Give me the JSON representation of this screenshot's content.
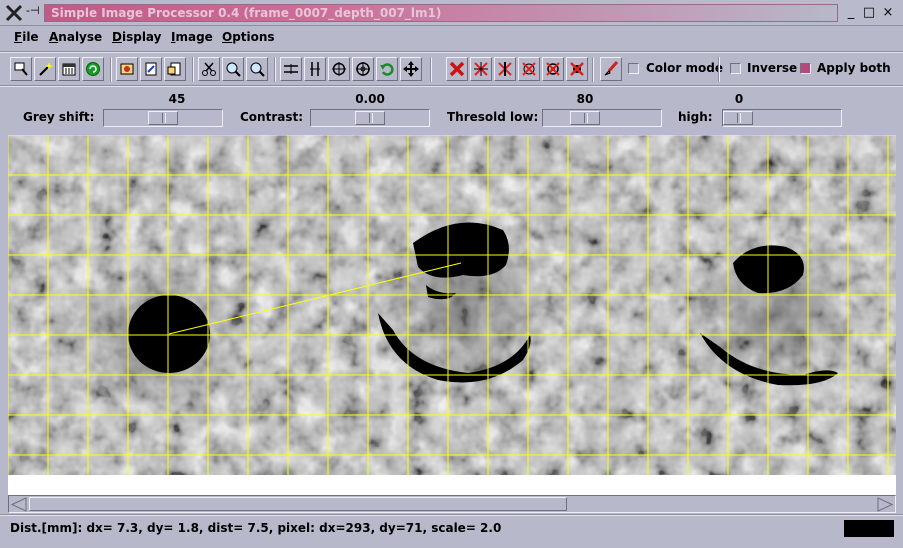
{
  "window": {
    "title": "Simple Image Processor 0.4 (frame_0007_depth_007_lm1)",
    "pin_glyph": "-⊣",
    "buttons": {
      "minimize": "_",
      "maximize": "□",
      "close": "×"
    }
  },
  "menu": {
    "items": [
      {
        "label": "File",
        "mnemonic": "F",
        "rest": "ile"
      },
      {
        "label": "Analyse",
        "mnemonic": "A",
        "rest": "nalyse"
      },
      {
        "label": "Display",
        "mnemonic": "D",
        "rest": "isplay"
      },
      {
        "label": "Image",
        "mnemonic": "I",
        "rest": "mage"
      },
      {
        "label": "Options",
        "mnemonic": "O",
        "rest": "ptions"
      }
    ]
  },
  "toolbar": {
    "icons": [
      "select-icon",
      "magic-wand-icon",
      "calendar-icon",
      "refresh-circle-icon",
      "image-load-icon",
      "image-save-icon",
      "image-export-icon",
      "scissors-icon",
      "zoom-in-icon",
      "zoom-out-icon",
      "hline-icon",
      "vline-icon",
      "circle-target-icon",
      "crosshair-circle-icon",
      "undo-arrow-icon",
      "move-icon",
      "delete-icon",
      "clear-cross-icon",
      "clear-star-icon",
      "clear-box-icon",
      "clear-dot-icon",
      "clear-all-icon",
      "brush-icon"
    ],
    "color_mode": {
      "label": "Color mode",
      "checked": false
    },
    "inverse": {
      "label": "Inverse",
      "checked": false
    },
    "apply_both": {
      "label": "Apply both",
      "checked": true
    },
    "accent": "#b44a7a"
  },
  "sliders": {
    "grey_shift": {
      "label": "Grey shift:",
      "value": "45",
      "fraction": 0.5
    },
    "contrast": {
      "label": "Contrast:",
      "value": "0.00",
      "fraction": 0.5
    },
    "threshold_low": {
      "label": "Thresold low:",
      "value": "80",
      "fraction": 0.31
    },
    "threshold_high": {
      "label": "high:",
      "value": "0",
      "fraction": 0.0
    }
  },
  "canvas": {
    "grid_color": "#ffff00",
    "measure_line_color": "#ffff00"
  },
  "status": {
    "text": "Dist.[mm]: dx= 7.3, dy= 1.8, dist= 7.5, pixel: dx=293, dy=71, scale= 2.0"
  }
}
